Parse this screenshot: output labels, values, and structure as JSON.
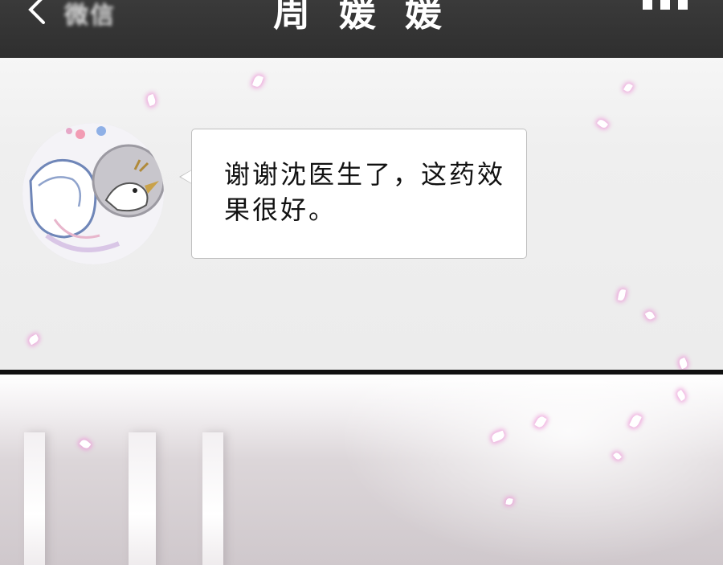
{
  "header": {
    "back_label": "微信",
    "title": "周 媛 媛"
  },
  "message": {
    "text": "谢谢沈医生了，这药效果很好。"
  },
  "colors": {
    "topbar": "#333333",
    "bubble": "#ffffff",
    "petal_glow": "#ec96d7"
  }
}
